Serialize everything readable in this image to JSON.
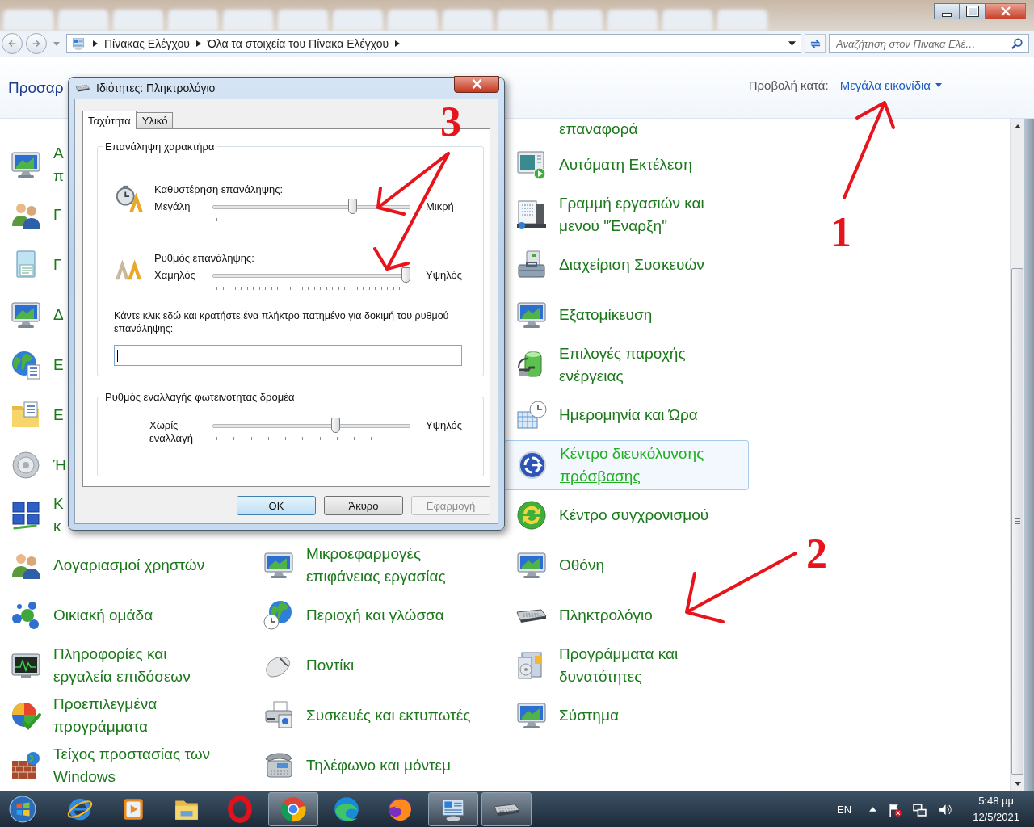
{
  "address_bar": {
    "breadcrumb": [
      "Πίνακας Ελέγχου",
      "Όλα τα στοιχεία του Πίνακα Ελέγχου"
    ],
    "search": {
      "placeholder": "Αναζήτηση στον Πίνακα Ελέ…"
    }
  },
  "header": {
    "title": "Προσαρ",
    "view_label": "Προβολή κατά:",
    "view_value": "Μεγάλα εικονίδια"
  },
  "items": {
    "column_1": [
      {
        "lines": [
          "Α",
          "π"
        ],
        "highlighted": false
      },
      {
        "lines": [
          "Γ"
        ],
        "highlighted": false
      },
      {
        "lines": [
          "Γ"
        ],
        "highlighted": false
      },
      {
        "lines": [
          "Δ"
        ],
        "highlighted": false
      },
      {
        "lines": [
          "Ε"
        ],
        "highlighted": false
      },
      {
        "lines": [
          "Ε"
        ],
        "highlighted": false
      },
      {
        "lines": [
          "Ή"
        ],
        "highlighted": false
      },
      {
        "lines": [
          "Κ",
          "κ"
        ],
        "highlighted": false
      },
      {
        "lines": [
          "Λογαριασμοί χρηστών"
        ],
        "highlighted": false
      },
      {
        "lines": [
          "Οικιακή ομάδα"
        ],
        "highlighted": false
      },
      {
        "lines": [
          "Πληροφορίες και",
          "εργαλεία επιδόσεων"
        ],
        "highlighted": false
      },
      {
        "lines": [
          "Προεπιλεγμένα",
          "προγράμματα"
        ],
        "highlighted": false
      },
      {
        "lines": [
          "Τείχος προστασίας των",
          "Windows"
        ],
        "highlighted": false
      }
    ],
    "column_2": [
      {
        "lines": [
          "Μικροεφαρμογές",
          "επιφάνειας εργασίας"
        ],
        "highlighted": false
      },
      {
        "lines": [
          "Περιοχή και γλώσσα"
        ],
        "highlighted": false
      },
      {
        "lines": [
          "Ποντίκι"
        ],
        "highlighted": false
      },
      {
        "lines": [
          "Συσκευές και εκτυπωτές"
        ],
        "highlighted": false
      },
      {
        "lines": [
          "Τηλέφωνο και μόντεμ"
        ],
        "highlighted": false
      }
    ],
    "column_3": [
      {
        "lines": [
          "επαναφορά"
        ],
        "highlighted": false
      },
      {
        "lines": [
          "Αυτόματη Εκτέλεση"
        ],
        "highlighted": false
      },
      {
        "lines": [
          "Γραμμή εργασιών και",
          "μενού \"Έναρξη\""
        ],
        "highlighted": false
      },
      {
        "lines": [
          "Διαχείριση Συσκευών"
        ],
        "highlighted": false
      },
      {
        "lines": [
          "Εξατομίκευση"
        ],
        "highlighted": false
      },
      {
        "lines": [
          "Επιλογές παροχής",
          "ενέργειας"
        ],
        "highlighted": false
      },
      {
        "lines": [
          "Ημερομηνία και Ώρα"
        ],
        "highlighted": false
      },
      {
        "lines": [
          "Κέντρο διευκόλυνσης",
          "πρόσβασης"
        ],
        "highlighted": true
      },
      {
        "lines": [
          "Κέντρο συγχρονισμού"
        ],
        "highlighted": false
      },
      {
        "lines": [
          "Οθόνη"
        ],
        "highlighted": false
      },
      {
        "lines": [
          "Πληκτρολόγιο"
        ],
        "highlighted": false
      },
      {
        "lines": [
          "Προγράμματα και",
          "δυνατότητες"
        ],
        "highlighted": false
      },
      {
        "lines": [
          "Σύστημα"
        ],
        "highlighted": false
      }
    ]
  },
  "dialog": {
    "title": "Ιδιότητες: Πληκτρολόγιο",
    "tabs": [
      {
        "label": "Ταχύτητα",
        "selected": true
      },
      {
        "label": "Υλικό",
        "selected": false
      }
    ],
    "groups": [
      {
        "legend": "Επανάληψη χαρακτήρα",
        "sliders": [
          {
            "caption": "Καθυστέρηση επανάληψης:",
            "min_label": "Μεγάλη",
            "max_label": "Μικρή",
            "level": 0.72
          },
          {
            "caption": "Ρυθμός επανάληψης:",
            "min_label": "Χαμηλός",
            "max_label": "Υψηλός",
            "level": 1
          }
        ],
        "test_prompt": "Κάντε κλικ εδώ και κρατήστε ένα πλήκτρο πατημένο για δοκιμή του ρυθμού επανάληψης:",
        "test_field": {
          "focused": true
        }
      },
      {
        "legend": "Ρυθμός εναλλαγής φωτεινότητας δρομέα",
        "sliders": [
          {
            "min_label": "Χωρίς εναλλαγή",
            "max_label": "Υψηλός",
            "level": 0.63
          }
        ]
      }
    ],
    "buttons": [
      {
        "label": "OK",
        "default": true,
        "disabled": false
      },
      {
        "label": "Άκυρο",
        "default": false,
        "disabled": false
      },
      {
        "label": "Εφαρμογή",
        "default": false,
        "disabled": true
      }
    ]
  },
  "annotations": [
    {
      "label": "1"
    },
    {
      "label": "2"
    },
    {
      "label": "3"
    }
  ],
  "taskbar": {
    "buttons": [
      {
        "running": false
      },
      {
        "running": false
      },
      {
        "running": false
      },
      {
        "running": false
      },
      {
        "running": true
      },
      {
        "running": false
      },
      {
        "running": false
      },
      {
        "running": true
      },
      {
        "running": true
      }
    ],
    "language": "EN",
    "time": "5:48 μμ",
    "date": "12/5/2021"
  }
}
